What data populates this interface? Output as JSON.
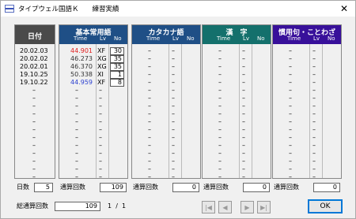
{
  "window": {
    "title": "タイプウェル国語Ｋ　　練習実績",
    "close_glyph": "✕"
  },
  "date_panel": {
    "header": "日付",
    "dates": [
      "20.02.03",
      "20.02.02",
      "20.02.01",
      "19.10.25",
      "19.10.22"
    ]
  },
  "panels": [
    {
      "title": "基本常用語",
      "color": "#1f4f86",
      "col_time": "Time",
      "col_lv": "Lv",
      "col_no": "No",
      "records": [
        {
          "time": "44.901",
          "lv": "XF",
          "no": "30",
          "color": "#e02020"
        },
        {
          "time": "46.273",
          "lv": "XG",
          "no": "35",
          "color": "#333333"
        },
        {
          "time": "46.370",
          "lv": "XG",
          "no": "35",
          "color": "#333333"
        },
        {
          "time": "50.338",
          "lv": "XI",
          "no": "1",
          "color": "#333333"
        },
        {
          "time": "44.959",
          "lv": "XF",
          "no": "8",
          "color": "#2a3fd0"
        }
      ],
      "count_label": "通算回数",
      "count_value": "109"
    },
    {
      "title": "カタカナ語",
      "color": "#1f4f86",
      "col_time": "Time",
      "col_lv": "Lv",
      "col_no": "No",
      "records": [],
      "count_label": "通算回数",
      "count_value": "0"
    },
    {
      "title": "漢　字",
      "color": "#14706c",
      "col_time": "Time",
      "col_lv": "Lv",
      "col_no": "No",
      "records": [],
      "count_label": "通算回数",
      "count_value": "0"
    },
    {
      "title": "慣用句・ことわざ",
      "color": "#38109a",
      "col_time": "Time",
      "col_lv": "Lv",
      "col_no": "No",
      "records": [],
      "count_label": "通算回数",
      "count_value": "0"
    }
  ],
  "dash": "–",
  "days": {
    "label": "日数",
    "value": "5"
  },
  "total": {
    "label": "総通算回数",
    "value": "109"
  },
  "paging": {
    "current": "1",
    "separator": "/",
    "total": "1"
  },
  "nav": {
    "first": "|◀",
    "prev": "◀",
    "next": "▶",
    "last": "▶|"
  },
  "ok_label": "OK"
}
